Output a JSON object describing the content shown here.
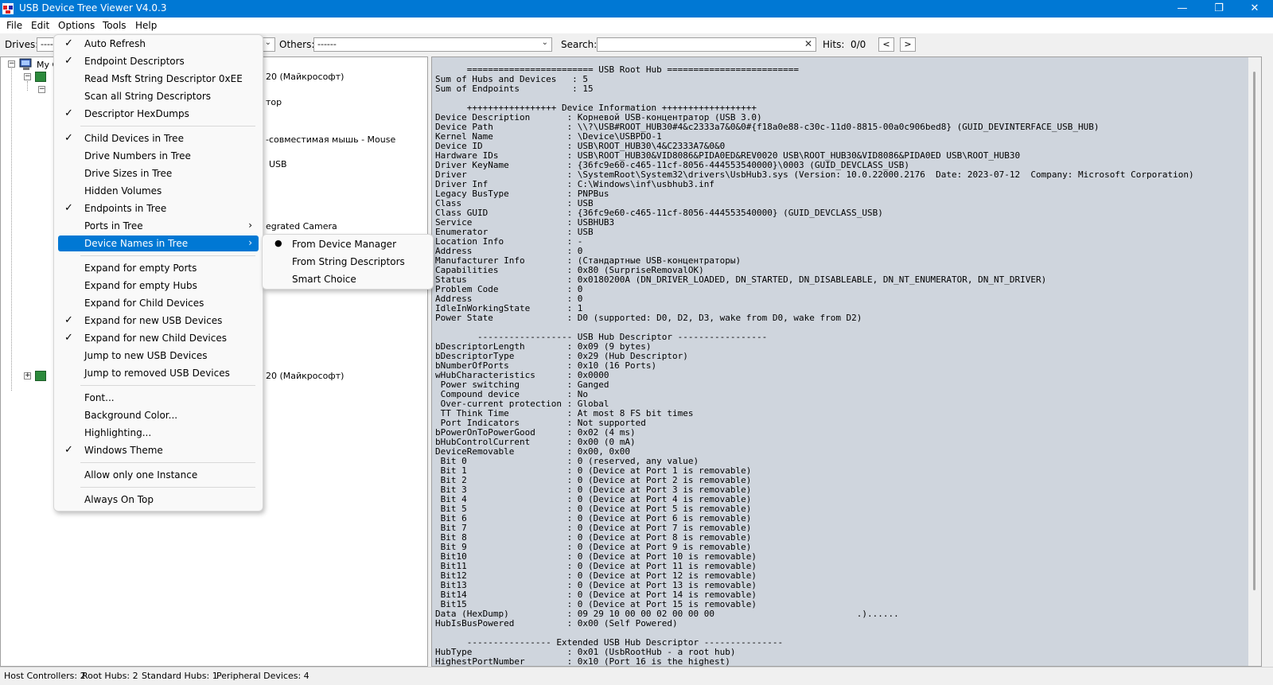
{
  "window": {
    "title": "USB Device Tree Viewer V4.0.3",
    "minimize_glyph": "—",
    "maximize_glyph": "❐",
    "close_glyph": "✕"
  },
  "menubar": [
    "File",
    "Edit",
    "Options",
    "Tools",
    "Help"
  ],
  "toolbar": {
    "drives_label": "Drives:",
    "drives_value": "----",
    "others_label": "Others:",
    "others_value": "------",
    "search_label": "Search:",
    "search_value": "",
    "hits_label": "Hits:",
    "hits_value": "0/0",
    "prev_glyph": "<",
    "next_glyph": ">"
  },
  "tree": {
    "root_label": "My C",
    "item_a": "20 (Майкрософт)",
    "item_b": "тор",
    "item_c": "-совместимая мышь - Mouse",
    "item_d": "USB",
    "item_e": "egrated Camera",
    "item_f": "20 (Майкрософт)"
  },
  "options_menu": {
    "items": [
      {
        "label": "Auto Refresh",
        "checked": true
      },
      {
        "label": "Endpoint Descriptors",
        "checked": true
      },
      {
        "label": "Read Msft String Descriptor 0xEE",
        "checked": false
      },
      {
        "label": "Scan all String Descriptors",
        "checked": false
      },
      {
        "label": "Descriptor HexDumps",
        "checked": true
      },
      {
        "label": "Child Devices in Tree",
        "checked": true
      },
      {
        "label": "Drive Numbers in Tree",
        "checked": false
      },
      {
        "label": "Drive Sizes in Tree",
        "checked": false
      },
      {
        "label": "Hidden Volumes",
        "checked": false
      },
      {
        "label": "Endpoints in Tree",
        "checked": true
      },
      {
        "label": "Ports in Tree",
        "checked": false,
        "submenu": true
      },
      {
        "label": "Device Names in Tree",
        "checked": false,
        "submenu": true,
        "highlighted": true
      },
      {
        "label": "Expand for empty Ports",
        "checked": false
      },
      {
        "label": "Expand for empty Hubs",
        "checked": false
      },
      {
        "label": "Expand for Child Devices",
        "checked": false
      },
      {
        "label": "Expand for new USB Devices",
        "checked": true
      },
      {
        "label": "Expand for new Child Devices",
        "checked": true
      },
      {
        "label": "Jump to new USB Devices",
        "checked": false
      },
      {
        "label": "Jump to removed USB Devices",
        "checked": false
      },
      {
        "label": "Font...",
        "checked": false
      },
      {
        "label": "Background Color...",
        "checked": false
      },
      {
        "label": "Highlighting...",
        "checked": false
      },
      {
        "label": "Windows Theme",
        "checked": true
      },
      {
        "label": "Allow only one Instance",
        "checked": false
      },
      {
        "label": "Always On Top",
        "checked": false
      }
    ],
    "check_glyph": "✓",
    "submenu_glyph": "›"
  },
  "device_names_submenu": {
    "items": [
      {
        "label": "From Device Manager",
        "selected": true
      },
      {
        "label": "From String Descriptors",
        "selected": false
      },
      {
        "label": "Smart Choice",
        "selected": false
      }
    ],
    "radio_glyph": "●"
  },
  "details_text": "      ======================== USB Root Hub =========================\nSum of Hubs and Devices   : 5\nSum of Endpoints          : 15\n\n      +++++++++++++++++ Device Information ++++++++++++++++++\nDevice Description       : Корневой USB-концентратор (USB 3.0)\nDevice Path              : \\\\?\\USB#ROOT_HUB30#4&c2333a7&0&0#{f18a0e88-c30c-11d0-8815-00a0c906bed8} (GUID_DEVINTERFACE_USB_HUB)\nKernel Name              : \\Device\\USBPDO-1\nDevice ID                : USB\\ROOT_HUB30\\4&C2333A7&0&0\nHardware IDs             : USB\\ROOT_HUB30&VID8086&PIDA0ED&REV0020 USB\\ROOT_HUB30&VID8086&PIDA0ED USB\\ROOT_HUB30\nDriver KeyName           : {36fc9e60-c465-11cf-8056-444553540000}\\0003 (GUID_DEVCLASS_USB)\nDriver                   : \\SystemRoot\\System32\\drivers\\UsbHub3.sys (Version: 10.0.22000.2176  Date: 2023-07-12  Company: Microsoft Corporation)\nDriver Inf               : C:\\Windows\\inf\\usbhub3.inf\nLegacy BusType           : PNPBus\nClass                    : USB\nClass GUID               : {36fc9e60-c465-11cf-8056-444553540000} (GUID_DEVCLASS_USB)\nService                  : USBHUB3\nEnumerator               : USB\nLocation Info            : -\nAddress                  : 0\nManufacturer Info        : (Стандартные USB-концентраторы)\nCapabilities             : 0x80 (SurpriseRemovalOK)\nStatus                   : 0x0180200A (DN_DRIVER_LOADED, DN_STARTED, DN_DISABLEABLE, DN_NT_ENUMERATOR, DN_NT_DRIVER)\nProblem Code             : 0\nAddress                  : 0\nIdleInWorkingState       : 1\nPower State              : D0 (supported: D0, D2, D3, wake from D0, wake from D2)\n\n        ------------------ USB Hub Descriptor -----------------\nbDescriptorLength        : 0x09 (9 bytes)\nbDescriptorType          : 0x29 (Hub Descriptor)\nbNumberOfPorts           : 0x10 (16 Ports)\nwHubCharacteristics      : 0x0000\n Power switching         : Ganged\n Compound device         : No\n Over-current protection : Global\n TT Think Time           : At most 8 FS bit times\n Port Indicators         : Not supported\nbPowerOnToPowerGood      : 0x02 (4 ms)\nbHubControlCurrent       : 0x00 (0 mA)\nDeviceRemovable          : 0x00, 0x00\n Bit 0                   : 0 (reserved, any value)\n Bit 1                   : 0 (Device at Port 1 is removable)\n Bit 2                   : 0 (Device at Port 2 is removable)\n Bit 3                   : 0 (Device at Port 3 is removable)\n Bit 4                   : 0 (Device at Port 4 is removable)\n Bit 5                   : 0 (Device at Port 5 is removable)\n Bit 6                   : 0 (Device at Port 6 is removable)\n Bit 7                   : 0 (Device at Port 7 is removable)\n Bit 8                   : 0 (Device at Port 8 is removable)\n Bit 9                   : 0 (Device at Port 9 is removable)\n Bit10                   : 0 (Device at Port 10 is removable)\n Bit11                   : 0 (Device at Port 11 is removable)\n Bit12                   : 0 (Device at Port 12 is removable)\n Bit13                   : 0 (Device at Port 13 is removable)\n Bit14                   : 0 (Device at Port 14 is removable)\n Bit15                   : 0 (Device at Port 15 is removable)\nData (HexDump)           : 09 29 10 00 00 02 00 00 00                           .)......\nHubIsBusPowered          : 0x00 (Self Powered)\n\n      ---------------- Extended USB Hub Descriptor ---------------\nHubType                  : 0x01 (UsbRootHub - a root hub)\nHighestPortNumber        : 0x10 (Port 16 is the highest)",
  "statusbar": {
    "host_controllers": "Host Controllers: 2",
    "root_hubs": "Root Hubs: 2",
    "standard_hubs": "Standard Hubs: 1",
    "peripheral_devices": "Peripheral Devices: 4"
  },
  "colors": {
    "title_bar": "#0078d4",
    "menu_highlight": "#0078d4",
    "details_background": "#cfd5dd"
  }
}
